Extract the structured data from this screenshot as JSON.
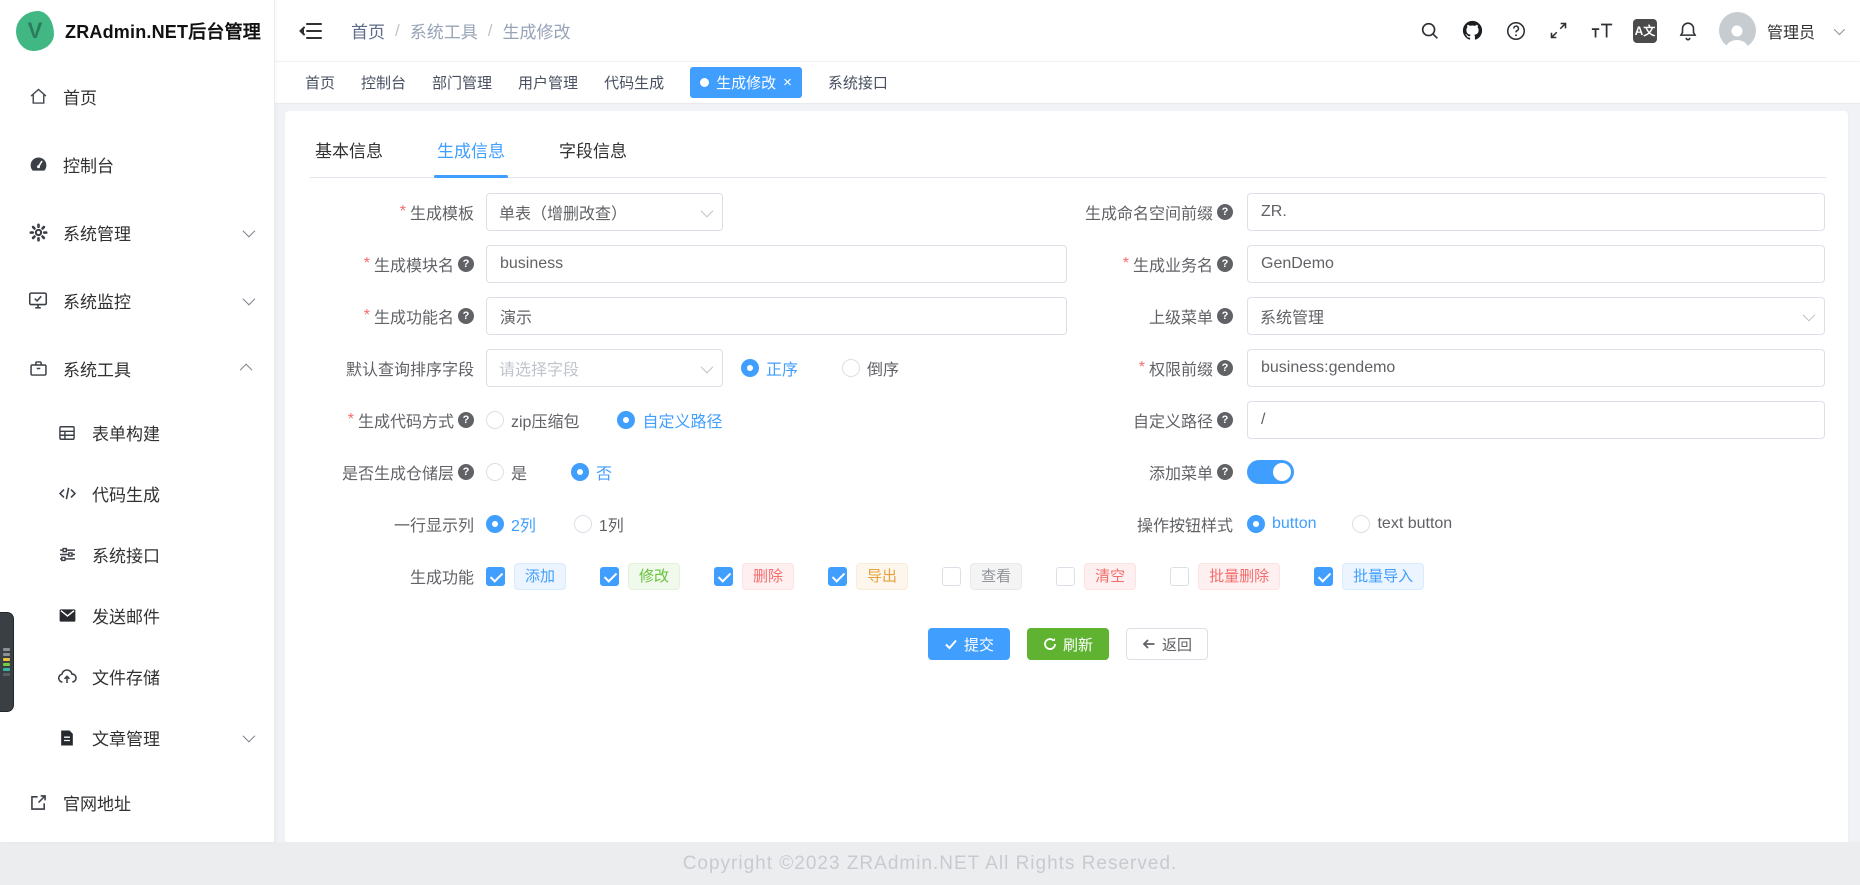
{
  "app": {
    "title": "ZRAdmin.NET后台管理"
  },
  "header": {
    "breadcrumb": [
      "首页",
      "系统工具",
      "生成修改"
    ],
    "icons": [
      "menu-fold",
      "search",
      "github",
      "help",
      "fullscreen",
      "font-size",
      "language",
      "notification"
    ],
    "language_icon_text": "A文",
    "user": "管理员"
  },
  "sidebar": {
    "items": [
      {
        "label": "首页",
        "icon": "home"
      },
      {
        "label": "控制台",
        "icon": "dashboard"
      },
      {
        "label": "系统管理",
        "icon": "gear",
        "chevron": "down"
      },
      {
        "label": "系统监控",
        "icon": "monitor",
        "chevron": "down"
      },
      {
        "label": "系统工具",
        "icon": "briefcase",
        "chevron": "up"
      },
      {
        "label": "表单构建",
        "icon": "table",
        "sub": true
      },
      {
        "label": "代码生成",
        "icon": "code",
        "sub": true
      },
      {
        "label": "系统接口",
        "icon": "sliders",
        "sub": true
      },
      {
        "label": "发送邮件",
        "icon": "mail",
        "sub": true
      },
      {
        "label": "文件存储",
        "icon": "cloud-upload",
        "sub": true
      },
      {
        "label": "文章管理",
        "icon": "document",
        "sub": true,
        "chevron": "down"
      },
      {
        "label": "官网地址",
        "icon": "external-link"
      }
    ]
  },
  "tags": {
    "items": [
      {
        "label": "首页"
      },
      {
        "label": "控制台"
      },
      {
        "label": "部门管理"
      },
      {
        "label": "用户管理"
      },
      {
        "label": "代码生成"
      },
      {
        "label": "生成修改",
        "active": true,
        "closable": true
      },
      {
        "label": "系统接口"
      }
    ]
  },
  "form_tabs": {
    "items": [
      "基本信息",
      "生成信息",
      "字段信息"
    ],
    "active": "生成信息"
  },
  "form": {
    "gen_template": {
      "label": "生成模板",
      "required": true,
      "value": "单表（增删改查）"
    },
    "namespace_prefix": {
      "label": "生成命名空间前缀",
      "value": "ZR."
    },
    "module_name": {
      "label": "生成模块名",
      "required": true,
      "value": "business"
    },
    "business_name": {
      "label": "生成业务名",
      "required": true,
      "value": "GenDemo"
    },
    "function_name": {
      "label": "生成功能名",
      "required": true,
      "value": "演示"
    },
    "parent_menu": {
      "label": "上级菜单",
      "value": "系统管理"
    },
    "sort_field": {
      "label": "默认查询排序字段",
      "placeholder": "请选择字段",
      "order_options": [
        "正序",
        "倒序"
      ],
      "selected": "正序"
    },
    "perm_prefix": {
      "label": "权限前缀",
      "required": true,
      "value": "business:gendemo"
    },
    "code_method": {
      "label": "生成代码方式",
      "required": true,
      "options": [
        "zip压缩包",
        "自定义路径"
      ],
      "selected": "自定义路径"
    },
    "custom_path": {
      "label": "自定义路径",
      "value": "/"
    },
    "repo_layer": {
      "label": "是否生成仓储层",
      "options": [
        "是",
        "否"
      ],
      "selected": "否"
    },
    "add_menu": {
      "label": "添加菜单",
      "enabled": true
    },
    "columns_per_row": {
      "label": "一行显示列",
      "options": [
        "2列",
        "1列"
      ],
      "selected": "2列"
    },
    "button_style": {
      "label": "操作按钮样式",
      "options": [
        "button",
        "text button"
      ],
      "selected": "button"
    },
    "gen_functions": {
      "label": "生成功能",
      "items": [
        {
          "label": "添加",
          "checked": true,
          "color": "blue"
        },
        {
          "label": "修改",
          "checked": true,
          "color": "green"
        },
        {
          "label": "删除",
          "checked": true,
          "color": "red"
        },
        {
          "label": "导出",
          "checked": true,
          "color": "orange"
        },
        {
          "label": "查看",
          "checked": false,
          "color": "gray"
        },
        {
          "label": "清空",
          "checked": false,
          "color": "red"
        },
        {
          "label": "批量删除",
          "checked": false,
          "color": "red"
        },
        {
          "label": "批量导入",
          "checked": true,
          "color": "blue"
        }
      ]
    }
  },
  "actions": {
    "submit": "提交",
    "refresh": "刷新",
    "back": "返回"
  },
  "footer": {
    "copyright": "Copyright ©2023 ZRAdmin.NET All Rights Reserved."
  },
  "colors": {
    "primary": "#409eff",
    "success": "#67c23a",
    "danger": "#f56c6c",
    "warning": "#e6a23c",
    "info": "#909399",
    "logo_green": "#41b883"
  }
}
